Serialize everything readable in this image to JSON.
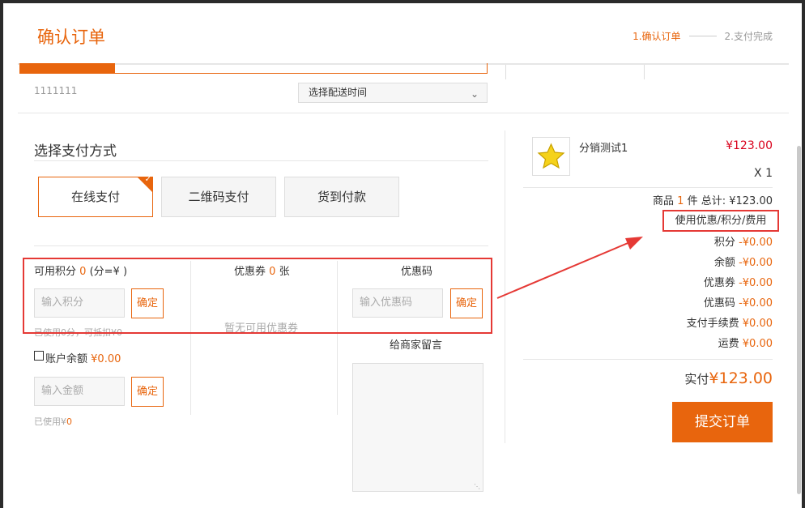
{
  "header": {
    "title": "确认订单",
    "steps": [
      "1.确认订单",
      "2.支付完成"
    ]
  },
  "delivery": {
    "address_code": "1111111",
    "time_select": "选择配送时间"
  },
  "payment": {
    "title": "选择支付方式",
    "methods": [
      "在线支付",
      "二维码支付",
      "货到付款"
    ],
    "selected": "在线支付"
  },
  "points": {
    "label_prefix": "可用积分",
    "value": "0",
    "label_suffix": "(分=¥ )",
    "placeholder": "输入积分",
    "confirm": "确定",
    "note": "已使用0分，可抵扣¥0"
  },
  "coupon": {
    "label_prefix": "优惠券",
    "count": "0",
    "label_suffix": "张",
    "empty": "暂无可用优惠券"
  },
  "promo": {
    "label": "优惠码",
    "placeholder": "输入优惠码",
    "confirm": "确定"
  },
  "balance": {
    "label": "账户余额",
    "value": "¥0.00",
    "placeholder": "输入金额",
    "confirm": "确定",
    "note_prefix": "已使用¥",
    "note_value": "0"
  },
  "message": {
    "label": "给商家留言"
  },
  "summary": {
    "product_name": "分销测试1",
    "product_price": "¥123.00",
    "product_qty": "X 1",
    "items_prefix": "商品",
    "items_count": "1",
    "items_suffix": "件 总计: ¥123.00",
    "discount_link": "使用优惠/积分/费用",
    "rows": [
      {
        "label": "积分",
        "value": "-¥0.00"
      },
      {
        "label": "余额",
        "value": "-¥0.00"
      },
      {
        "label": "优惠券",
        "value": "-¥0.00"
      },
      {
        "label": "优惠码",
        "value": "-¥0.00"
      },
      {
        "label": "支付手续费",
        "value": "¥0.00"
      },
      {
        "label": "运费",
        "value": "¥0.00"
      }
    ],
    "final_label": "实付",
    "final_value": "¥123.00",
    "submit": "提交订单"
  },
  "colors": {
    "accent": "#e8650d",
    "price_red": "#d9001b",
    "annotation_red": "#e53935"
  }
}
